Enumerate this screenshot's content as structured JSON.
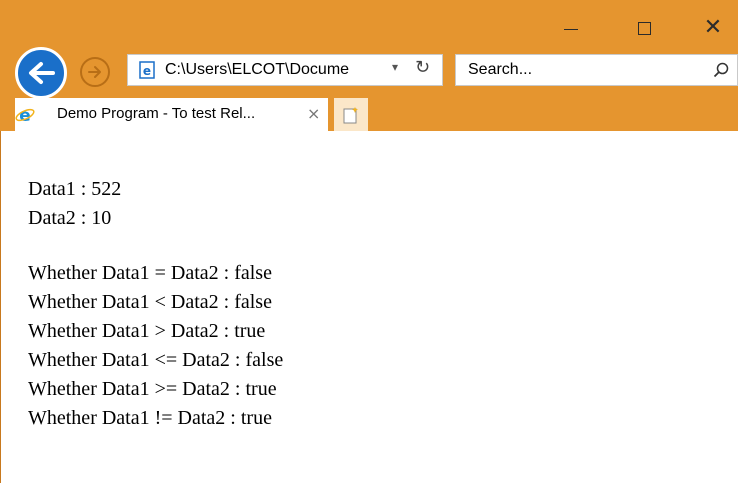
{
  "window": {
    "controls": [
      "minimize",
      "maximize",
      "close"
    ]
  },
  "toolbar": {
    "back_icon": "back-arrow-icon",
    "forward_icon": "forward-arrow-icon",
    "address": "C:\\Users\\ELCOT\\Docume",
    "dropdown_glyph": "▾",
    "refresh_glyph": "↻",
    "search_placeholder": "Search...",
    "search_icon": "magnifier-icon"
  },
  "tab": {
    "title": "Demo Program - To test Rel...",
    "close_glyph": "×",
    "icon": "ie-icon"
  },
  "content": {
    "data_lines": [
      "Data1 : 522",
      "Data2 : 10"
    ],
    "comparisons": [
      "Whether Data1 = Data2 : false",
      "Whether Data1 < Data2 : false",
      "Whether Data1 > Data2 : true",
      "Whether Data1 <= Data2 : false",
      "Whether Data1 >= Data2 : true",
      "Whether Data1 != Data2 : true"
    ]
  },
  "colors": {
    "chrome": "#e5952f",
    "back_button": "#1a6fc9"
  }
}
